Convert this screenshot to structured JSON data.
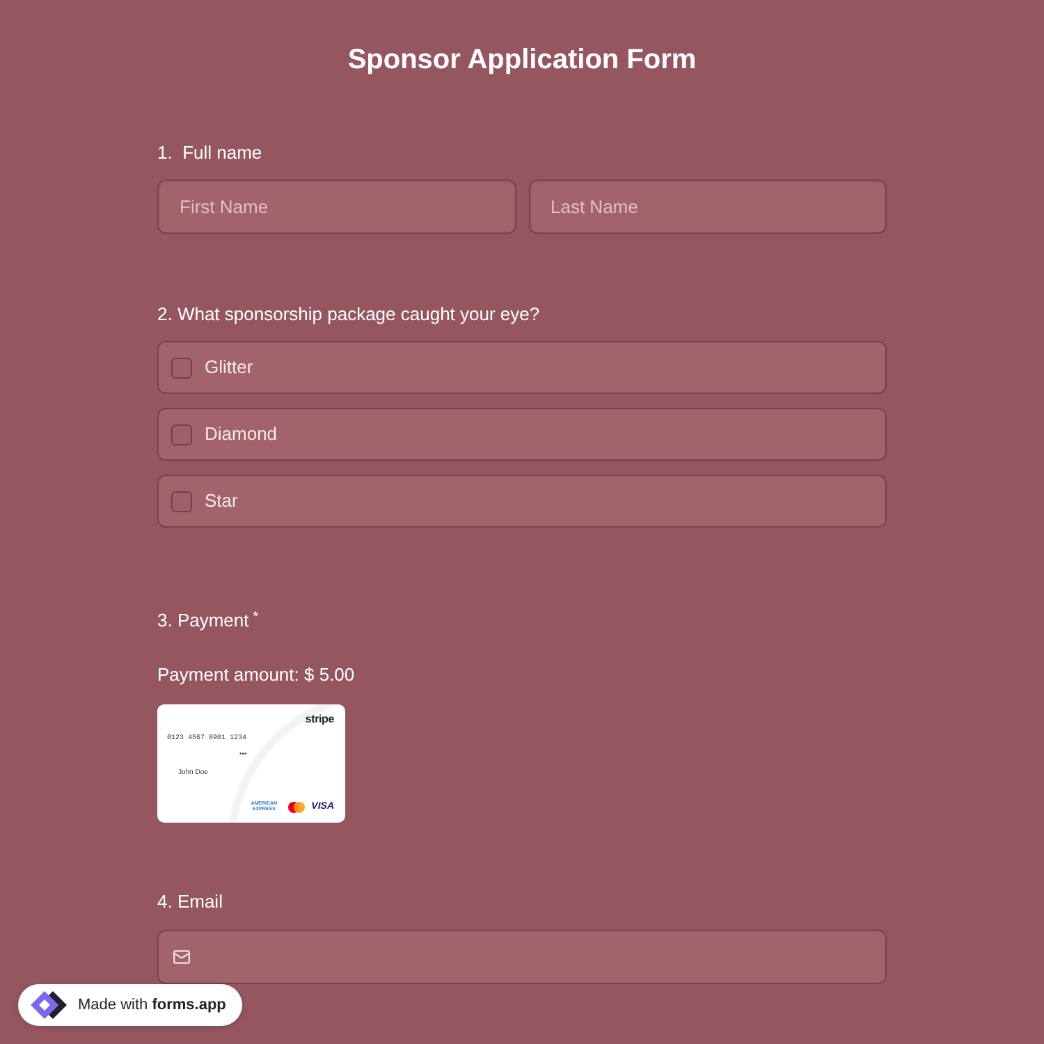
{
  "form": {
    "title": "Sponsor Application Form"
  },
  "questions": [
    {
      "kind": "name",
      "title": "1.  Full name",
      "fields": [
        {
          "placeholder": "First Name"
        },
        {
          "placeholder": "Last Name"
        }
      ]
    },
    {
      "kind": "checkboxes",
      "title": "2. What sponsorship package caught your eye?",
      "options": [
        {
          "label": "Glitter",
          "checked": false
        },
        {
          "label": "Diamond",
          "checked": false
        },
        {
          "label": "Star",
          "checked": false
        }
      ]
    },
    {
      "kind": "payment",
      "title": "3. Payment",
      "required_mark": "*",
      "amount": "Payment amount: $ 5.00",
      "card": {
        "brand": "stripe",
        "number": "0123 4567 8901 1234",
        "cvv": "•••",
        "holder": "John Doe",
        "networks": [
          {
            "kind": "amex",
            "text": "AMERICAN EXPRESS"
          },
          {
            "kind": "mastercard"
          },
          {
            "kind": "visa",
            "text": "VISA"
          }
        ]
      }
    },
    {
      "kind": "email",
      "title": "4. Email"
    }
  ],
  "badge": {
    "text": "Made with **forms.app**"
  }
}
